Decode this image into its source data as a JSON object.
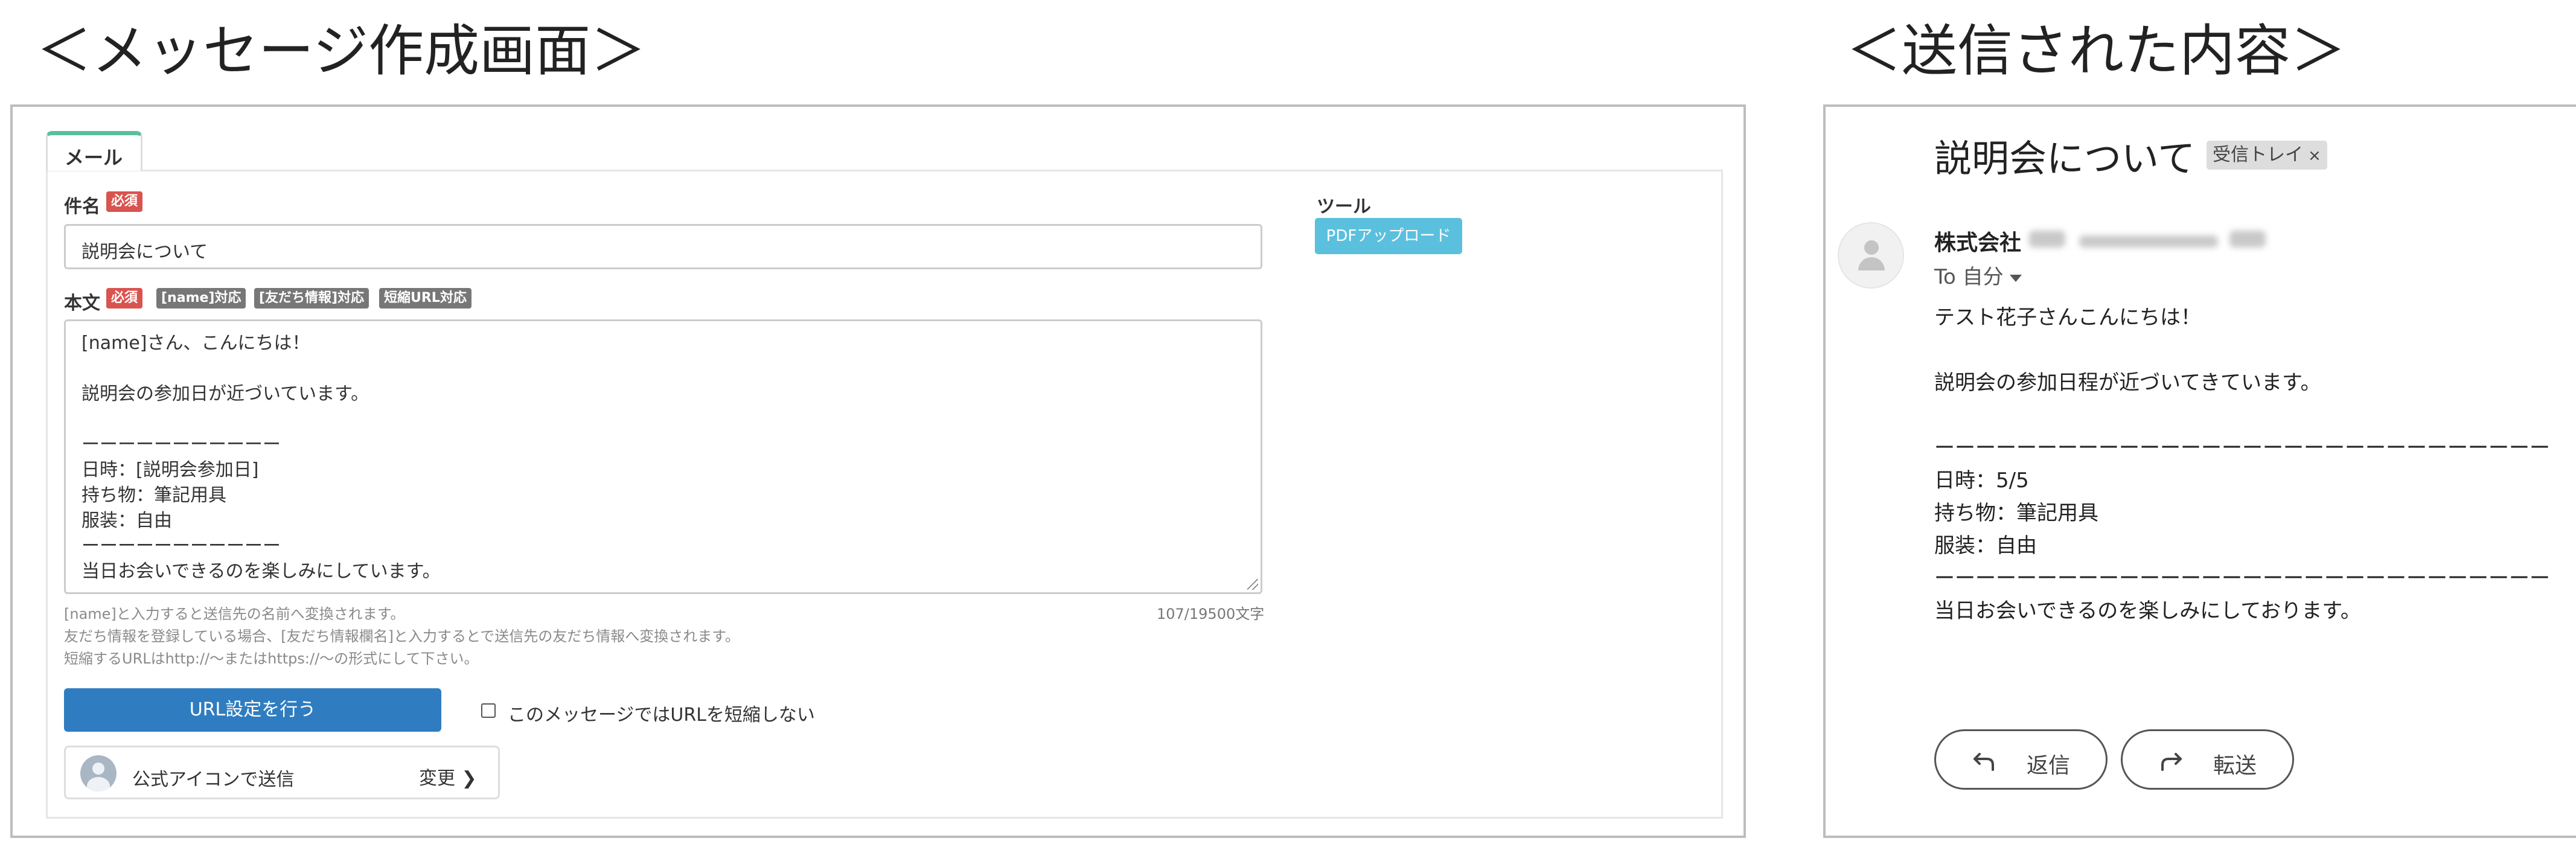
{
  "headings": {
    "left": "＜メッセージ作成画面＞",
    "right": "＜送信された内容＞"
  },
  "compose": {
    "tab_label": "メール",
    "subject": {
      "label": "件名",
      "required_badge": "必須",
      "value": "説明会について"
    },
    "body": {
      "label": "本文",
      "badges": [
        "必須",
        "[name]対応",
        "[友だち情報]対応",
        "短縮URL対応"
      ],
      "lines": [
        "[name]さん、こんにちは！",
        "",
        "説明会の参加日が近づいています。",
        "",
        "ーーーーーーーーーーー",
        "日時：[説明会参加日]",
        "持ち物：筆記用具",
        "服装：自由",
        "ーーーーーーーーーーー",
        "当日お会いできるのを楽しみにしています。"
      ],
      "char_count": "107/19500文字"
    },
    "help_lines": [
      "[name]と入力すると送信先の名前へ変換されます。",
      "友だち情報を登録している場合、[友だち情報欄名]と入力するとで送信先の友だち情報へ変換されます。",
      "短縮するURLはhttp://〜またはhttps://〜の形式にして下さい。"
    ],
    "url_button": "URL設定を行う",
    "no_shorten_label": "このメッセージではURLを短縮しない",
    "no_shorten_checked": false,
    "sender_label": "公式アイコンで送信",
    "change_label": "変更",
    "tools_label": "ツール",
    "pdf_button": "PDFアップロード"
  },
  "mail_view": {
    "subject": "説明会について",
    "inbox_badge": "受信トレイ",
    "inbox_badge_close": "×",
    "from_name": "株式会社",
    "to_label": "To 自分",
    "body_lines": [
      "テスト花子さんこんにちは！",
      "",
      "説明会の参加日程が近づいてきています。",
      "",
      "ーーーーーーーーーーーーーーーーーーーーーーーーーーーーーー",
      "日時：5/5",
      "持ち物：筆記用具",
      "服装：自由",
      "ーーーーーーーーーーーーーーーーーーーーーーーーーーーーーー",
      "当日お会いできるのを楽しみにしております。"
    ],
    "reply_button": "返信",
    "forward_button": "転送"
  },
  "colors": {
    "tab_accent": "#5bbf9f",
    "required_badge": "#d9534f",
    "tag_badge": "#777777",
    "primary_button": "#2f7dc0",
    "info_button": "#5bc0de"
  }
}
